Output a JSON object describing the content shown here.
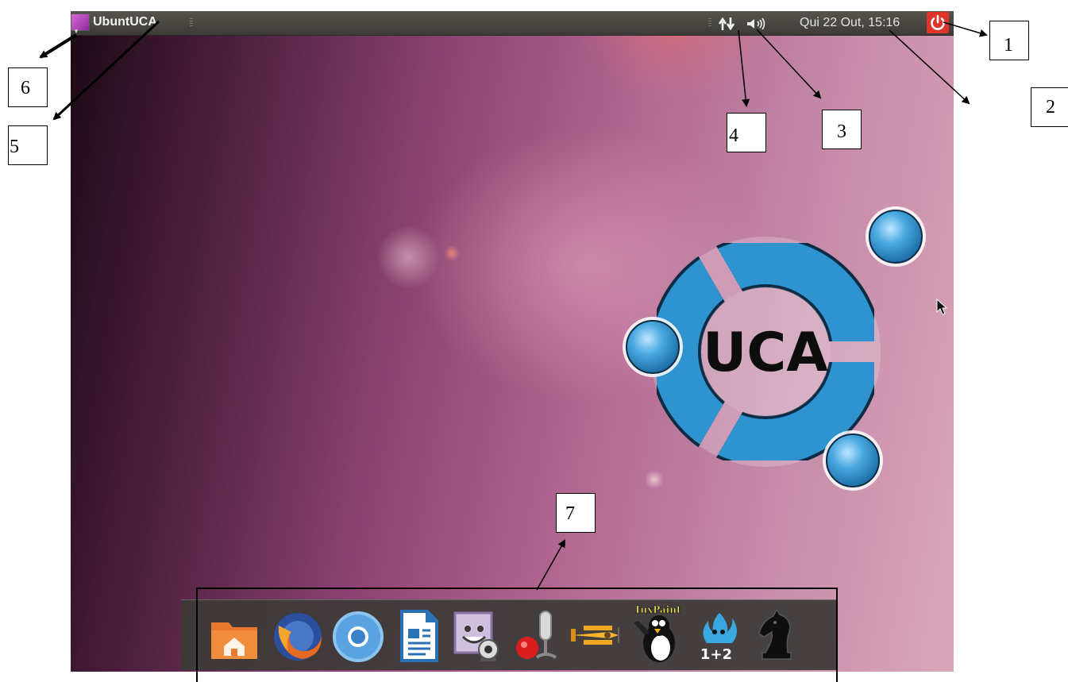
{
  "topbar": {
    "app_title": "UbuntUCA",
    "clock": "Qui 22 Out, 15:16",
    "icons": [
      "application-menu-icon",
      "network-arrows-icon",
      "volume-icon",
      "power-icon"
    ]
  },
  "desktop": {
    "logo_text": "UCA"
  },
  "dock": {
    "items": [
      {
        "name": "home-folder-icon"
      },
      {
        "name": "firefox-icon"
      },
      {
        "name": "chromium-icon"
      },
      {
        "name": "writer-document-icon"
      },
      {
        "name": "webcam-photo-icon"
      },
      {
        "name": "sound-recorder-icon"
      },
      {
        "name": "biplane-game-icon"
      },
      {
        "name": "tuxpaint-icon",
        "label": "TuxPaint"
      },
      {
        "name": "tuxmath-icon",
        "label": "1+2"
      },
      {
        "name": "chess-knight-icon"
      }
    ]
  },
  "annotations": {
    "labels": [
      "1",
      "2",
      "3",
      "4",
      "5",
      "6",
      "7"
    ]
  },
  "colors": {
    "topbar": "#3d3b37",
    "power": "#e0342a",
    "logo_blue": "#2f93cf",
    "dock": "#3c3a38"
  }
}
